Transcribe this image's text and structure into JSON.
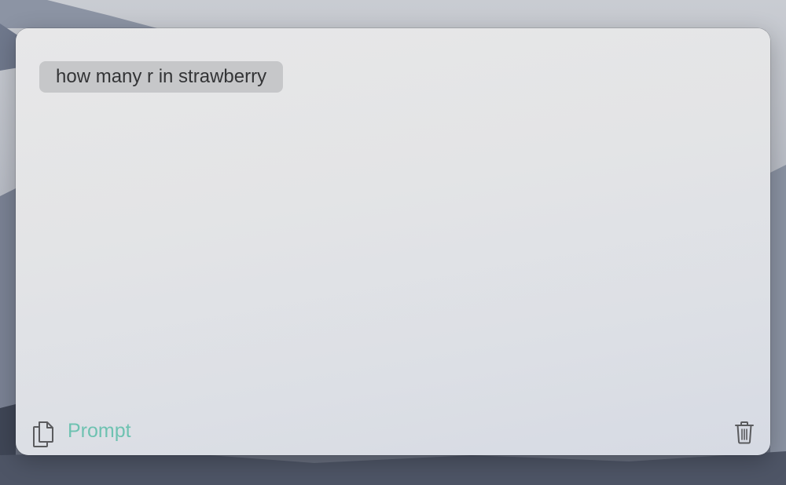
{
  "query": {
    "text": "how many r in strawberry"
  },
  "footer": {
    "copy_icon": "copy-documents-icon",
    "prompt_label": "Prompt",
    "trash_icon": "trash-icon"
  },
  "colors": {
    "accent": "#6ec2b1",
    "chip_background": "#c6c7c9",
    "chip_text": "#333436",
    "icon": "#5a5b5e"
  }
}
